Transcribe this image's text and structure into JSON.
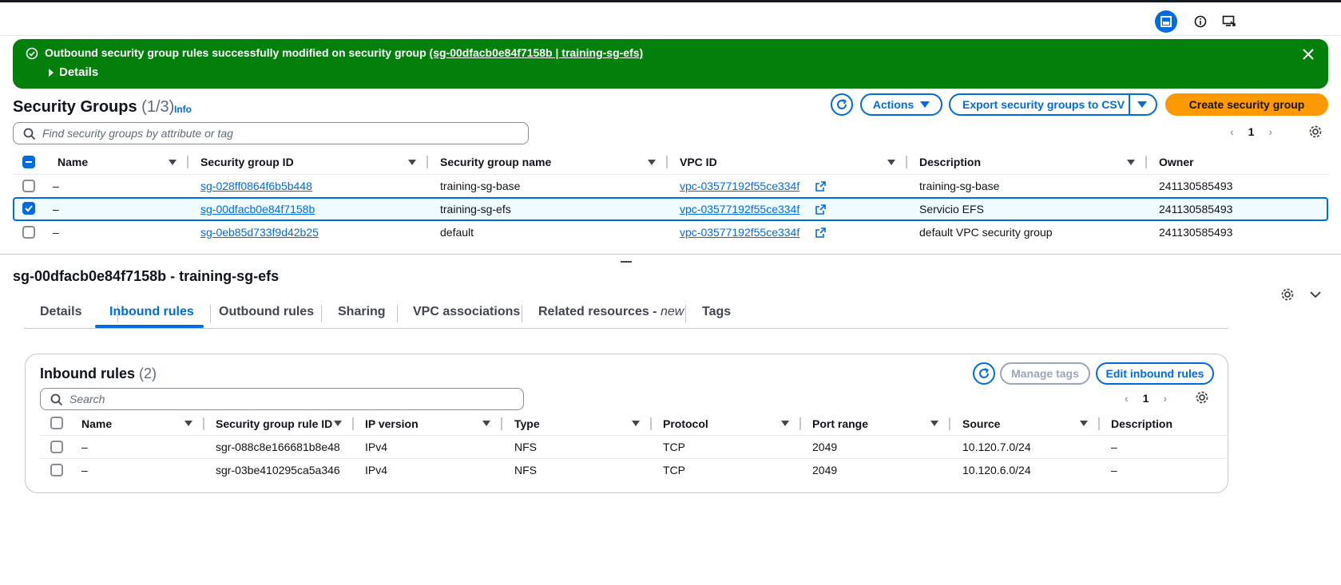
{
  "topbar": {
    "icons": [
      "split-panel-icon",
      "info-icon",
      "feedback-icon"
    ]
  },
  "flash": {
    "message": "Outbound security group rules successfully modified on security group",
    "link": "(sg-00dfacb0e84f7158b | training-sg-efs)",
    "details_label": "Details",
    "color": "#037f0c"
  },
  "security_groups": {
    "title": "Security Groups",
    "count": "(1/3)",
    "info_label": "Info",
    "actions_label": "Actions",
    "export_label": "Export security groups to CSV",
    "create_label": "Create security group",
    "search_placeholder": "Find security groups by attribute or tag",
    "page": "1",
    "columns": [
      "Name",
      "Security group ID",
      "Security group name",
      "VPC ID",
      "Description",
      "Owner"
    ],
    "rows": [
      {
        "name": "–",
        "sg_id": "sg-028ff0864f6b5b448",
        "sg_name": "training-sg-base",
        "vpc": "vpc-03577192f55ce334f",
        "description": "training-sg-base",
        "owner": "241130585493",
        "selected": false
      },
      {
        "name": "–",
        "sg_id": "sg-00dfacb0e84f7158b",
        "sg_name": "training-sg-efs",
        "vpc": "vpc-03577192f55ce334f",
        "description": "Servicio EFS",
        "owner": "241130585493",
        "selected": true
      },
      {
        "name": "–",
        "sg_id": "sg-0eb85d733f9d42b25",
        "sg_name": "default",
        "vpc": "vpc-03577192f55ce334f",
        "description": "default VPC security group",
        "owner": "241130585493",
        "selected": false
      }
    ]
  },
  "detail": {
    "title": "sg-00dfacb0e84f7158b - training-sg-efs",
    "tabs": [
      "Details",
      "Inbound rules",
      "Outbound rules",
      "Sharing",
      "VPC associations",
      "Related resources - ",
      "Tags"
    ],
    "tab_new": "new",
    "active_tab": "Inbound rules"
  },
  "inbound": {
    "title": "Inbound rules",
    "count": "(2)",
    "manage_tags_label": "Manage tags",
    "edit_label": "Edit inbound rules",
    "search_placeholder": "Search",
    "page": "1",
    "columns": [
      "Name",
      "Security group rule ID",
      "IP version",
      "Type",
      "Protocol",
      "Port range",
      "Source",
      "Description"
    ],
    "rows": [
      {
        "name": "–",
        "rule_id": "sgr-088c8e166681b8e48",
        "ip": "IPv4",
        "type": "NFS",
        "protocol": "TCP",
        "port": "2049",
        "source": "10.120.7.0/24",
        "description": "–"
      },
      {
        "name": "–",
        "rule_id": "sgr-03be410295ca5a346",
        "ip": "IPv4",
        "type": "NFS",
        "protocol": "TCP",
        "port": "2049",
        "source": "10.120.6.0/24",
        "description": "–"
      }
    ]
  },
  "colors": {
    "accent": "#006ce0",
    "primary": "#ff9900"
  }
}
